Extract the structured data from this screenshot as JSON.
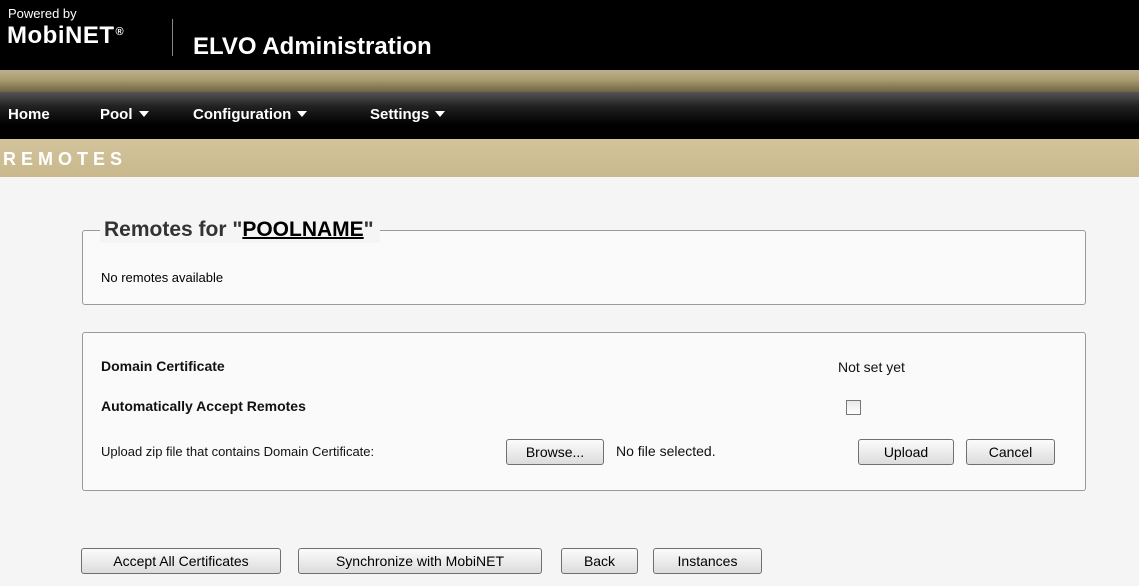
{
  "header": {
    "powered_by": "Powered by",
    "brand": "MobiNET",
    "brand_mark": "®",
    "app_title": "ELVO Administration"
  },
  "nav": {
    "items": [
      {
        "label": "Home",
        "has_dropdown": false
      },
      {
        "label": "Pool",
        "has_dropdown": true
      },
      {
        "label": "Configuration",
        "has_dropdown": true
      },
      {
        "label": "Settings",
        "has_dropdown": true
      }
    ]
  },
  "section": {
    "title": "REMOTES"
  },
  "remotes": {
    "legend_prefix": "Remotes for \"",
    "pool_name": "POOLNAME",
    "legend_suffix": "\"",
    "empty_message": "No remotes available"
  },
  "certificate": {
    "domain_label": "Domain Certificate",
    "domain_status": "Not set yet",
    "auto_accept_label": "Automatically Accept Remotes",
    "auto_accept_checked": false,
    "upload_label": "Upload zip file that contains Domain Certificate:",
    "browse_label": "Browse...",
    "file_status": "No file selected.",
    "upload_button": "Upload",
    "cancel_button": "Cancel"
  },
  "actions": {
    "accept_all": "Accept All Certificates",
    "synchronize": "Synchronize with MobiNET",
    "back": "Back",
    "instances": "Instances"
  },
  "colors": {
    "header_bg": "#000000",
    "accent_stripe": "#a99a70",
    "section_bar": "#c8b88c"
  }
}
